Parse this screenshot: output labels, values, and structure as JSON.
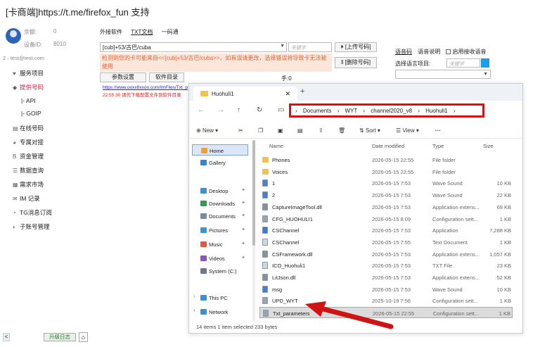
{
  "app": {
    "title": "[卡商端]https://t.me/firefox_fun 支持"
  },
  "account": {
    "balance_label": "余额:",
    "balance": "0",
    "device_label": "设备ID:",
    "device": "8010",
    "user": "2 - test@test.com"
  },
  "menu": [
    {
      "label": "服务项目",
      "icon": "♥"
    },
    {
      "label": "提供号码",
      "icon": "◆",
      "active": true
    },
    {
      "label": "|- API",
      "sub": true
    },
    {
      "label": "|- GOIP",
      "sub": true
    },
    {
      "label": "在线号码",
      "icon": "▤"
    },
    {
      "label": "专属对接",
      "icon": "◕"
    },
    {
      "label": "资金管理",
      "icon": "B"
    },
    {
      "label": "数据查询",
      "icon": "☰"
    },
    {
      "label": "需求市场",
      "icon": "▦"
    },
    {
      "label": "IM 记录",
      "icon": "✉"
    },
    {
      "label": "TG消息订阅",
      "icon": "◔"
    },
    {
      "label": "子账号管理",
      "icon": "◐"
    }
  ],
  "footer": {
    "arrow": "<",
    "log_button": "升级日志",
    "home": "⌂"
  },
  "topnav": {
    "items": [
      "外接软件",
      "TXT文档",
      "一码通"
    ]
  },
  "controls": {
    "combo_value": "[cub]+53/古巴/cuba",
    "keyword_placeholder": "关键字",
    "upload_label": "⏵ [上传号码]",
    "delete_label": "‖ [删除号码]",
    "warning": "检测到您的卡可能来自<<[cub]+53/古巴/cuba>>，如有误请更改，选择错误将导致卡无法被使用",
    "param_button": "参数设置",
    "software_dir_button": "软件目录",
    "hand_label": "手:0",
    "link_text": "https://www.ooxx8xxoo.com/ImFiles/Txt_p",
    "red_text": "22:55:30 请先下载配置文件到软件目录"
  },
  "right_panel": {
    "tab_code": "语音码",
    "tab_desc": "语音说明",
    "enable_label": "启用接收语音",
    "lang_label": "选择语言项目:",
    "keyword_placeholder": "关键字"
  },
  "explorer": {
    "tab_title": "Huohuli1",
    "breadcrumb": [
      "Documents",
      "WYT",
      "channel2020_v8",
      "Huohuli1"
    ],
    "toolbar": {
      "new": "New",
      "sort": "Sort",
      "view": "View",
      "more": "···"
    },
    "nav": [
      {
        "label": "Home",
        "icon": "home",
        "selected": true
      },
      {
        "label": "Gallery",
        "icon": "gallery"
      },
      {
        "label": "Desktop",
        "icon": "desktop",
        "pin": true
      },
      {
        "label": "Downloads",
        "icon": "downloads",
        "pin": true
      },
      {
        "label": "Documents",
        "icon": "documents",
        "pin": true
      },
      {
        "label": "Pictures",
        "icon": "pictures",
        "pin": true
      },
      {
        "label": "Music",
        "icon": "music",
        "pin": true
      },
      {
        "label": "Videos",
        "icon": "videos",
        "pin": true
      },
      {
        "label": "System (C:)",
        "icon": "drive"
      },
      {
        "label": "This PC",
        "icon": "pc",
        "chevron": true
      },
      {
        "label": "Network",
        "icon": "network",
        "chevron": true
      }
    ],
    "columns": {
      "name": "Name",
      "date": "Date modified",
      "type": "Type",
      "size": "Size"
    },
    "rows": [
      {
        "name": "Phones",
        "date": "2026-05-15 22:55",
        "type": "File folder",
        "size": "",
        "icon": "folder"
      },
      {
        "name": "Voices",
        "date": "2026-05-15 22:55",
        "type": "File folder",
        "size": "",
        "icon": "folder"
      },
      {
        "name": "1",
        "date": "2026-05-15 7:53",
        "type": "Wave Sound",
        "size": "10 KB",
        "icon": "audio"
      },
      {
        "name": "2",
        "date": "2026-05-15 7:53",
        "type": "Wave Sound",
        "size": "22 KB",
        "icon": "audio"
      },
      {
        "name": "CaptureImageTool.dll",
        "date": "2026-05-15 7:53",
        "type": "Application extens...",
        "size": "69 KB",
        "icon": "dll"
      },
      {
        "name": "CFG_HUOHULI1",
        "date": "2026-05-15 8:09",
        "type": "Configuration sett...",
        "size": "1 KB",
        "icon": "cfg"
      },
      {
        "name": "CSChannel",
        "date": "2026-05-15 7:53",
        "type": "Application",
        "size": "7,288 KB",
        "icon": "app"
      },
      {
        "name": "CSChannel",
        "date": "2026-05-15 7:55",
        "type": "Text Document",
        "size": "1 KB",
        "icon": "txt"
      },
      {
        "name": "CSFramework.dll",
        "date": "2026-05-15 7:53",
        "type": "Application extens...",
        "size": "1,057 KB",
        "icon": "dll"
      },
      {
        "name": "ICO_Huohuli1",
        "date": "2026-05-15 7:53",
        "type": "TXT File",
        "size": "23 KB",
        "icon": "txt"
      },
      {
        "name": "LitJson.dll",
        "date": "2026-05-15 7:53",
        "type": "Application extens...",
        "size": "52 KB",
        "icon": "dll"
      },
      {
        "name": "msg",
        "date": "2026-05-15 7:53",
        "type": "Wave Sound",
        "size": "10 KB",
        "icon": "audio"
      },
      {
        "name": "UPD_WYT",
        "date": "2025-10-19 7:56",
        "type": "Configuration sett...",
        "size": "1 KB",
        "icon": "cfg"
      },
      {
        "name": "Txt_parameters",
        "date": "2026-05-15 22:55",
        "type": "Configuration sett...",
        "size": "1 KB",
        "icon": "cfg",
        "selected": true
      }
    ],
    "status": "14 items    1 item selected  233 bytes"
  },
  "colors": {
    "highlight": "#d01414",
    "folder": "#f2c14e",
    "accent": "#1aa0e8",
    "warning_bg": "#fbe6da"
  }
}
